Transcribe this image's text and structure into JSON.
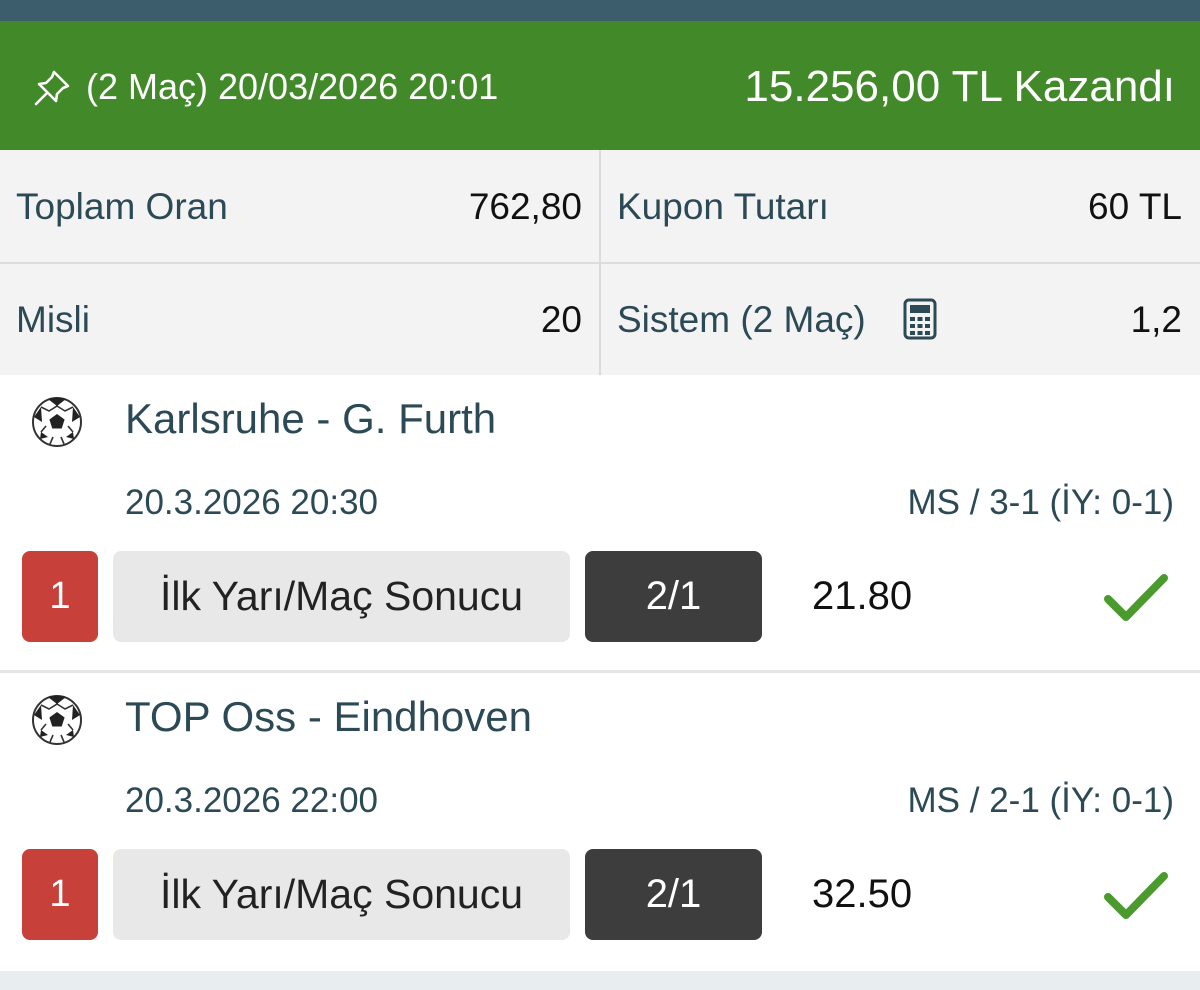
{
  "colors": {
    "header_bg": "#42892a",
    "top_strip": "#3c5d6b",
    "badge_red": "#c8403a",
    "pick_dark": "#3d3d3d",
    "check_green": "#4a9a2e",
    "text_teal": "#2c4a55"
  },
  "header": {
    "icon": "pin-icon",
    "title": "(2 Maç) 20/03/2026 20:01",
    "result": "15.256,00 TL Kazandı"
  },
  "summary": {
    "total_odds_label": "Toplam Oran",
    "total_odds_value": "762,80",
    "coupon_amount_label": "Kupon Tutarı",
    "coupon_amount_value": "60 TL",
    "multiplier_label": "Misli",
    "multiplier_value": "20",
    "system_label": "Sistem (2 Maç)",
    "system_icon": "calculator-icon",
    "system_value": "1,2"
  },
  "matches": [
    {
      "icon": "soccer-ball-icon",
      "teams": "Karlsruhe - G. Furth",
      "datetime": "20.3.2026 20:30",
      "score": "MS / 3-1 (İY: 0-1)",
      "index": "1",
      "market": "İlk Yarı/Maç Sonucu",
      "pick": "2/1",
      "odds": "21.80",
      "status_icon": "check-icon"
    },
    {
      "icon": "soccer-ball-icon",
      "teams": "TOP Oss - Eindhoven",
      "datetime": "20.3.2026 22:00",
      "score": "MS / 2-1 (İY: 0-1)",
      "index": "1",
      "market": "İlk Yarı/Maç Sonucu",
      "pick": "2/1",
      "odds": "32.50",
      "status_icon": "check-icon"
    }
  ]
}
